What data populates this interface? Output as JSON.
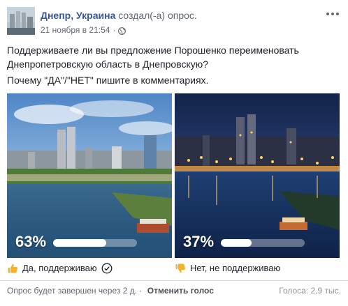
{
  "post": {
    "author": "Днепр, Украина",
    "action": "создал(-а) опрос.",
    "date": "21 ноября в 21:54",
    "separator": "·",
    "privacy_icon": "globe-icon",
    "menu_icon": "more-dots-icon"
  },
  "poll": {
    "question": "Поддерживаете ли вы предложение Порошенко переименовать Днепропетровскую область в Днепровскую?",
    "prompt": "Почему \"ДА\"/\"НЕТ\" пишите в комментариях.",
    "options": [
      {
        "percent_label": "63%",
        "percent": 63,
        "label": "Да, поддерживаю",
        "icon": "thumbs-up-icon",
        "selected": true
      },
      {
        "percent_label": "37%",
        "percent": 37,
        "label": "Нет, не поддерживаю",
        "icon": "thumbs-down-icon",
        "selected": false
      }
    ]
  },
  "footer": {
    "status": "Опрос будет завершен через 2 д.",
    "separator": "·",
    "cancel_vote": "Отменить голос",
    "votes": "Голоса: 2,9 тыс."
  },
  "colors": {
    "link": "#385898",
    "secondary_text": "#616770",
    "emoji": "#f7b125"
  }
}
